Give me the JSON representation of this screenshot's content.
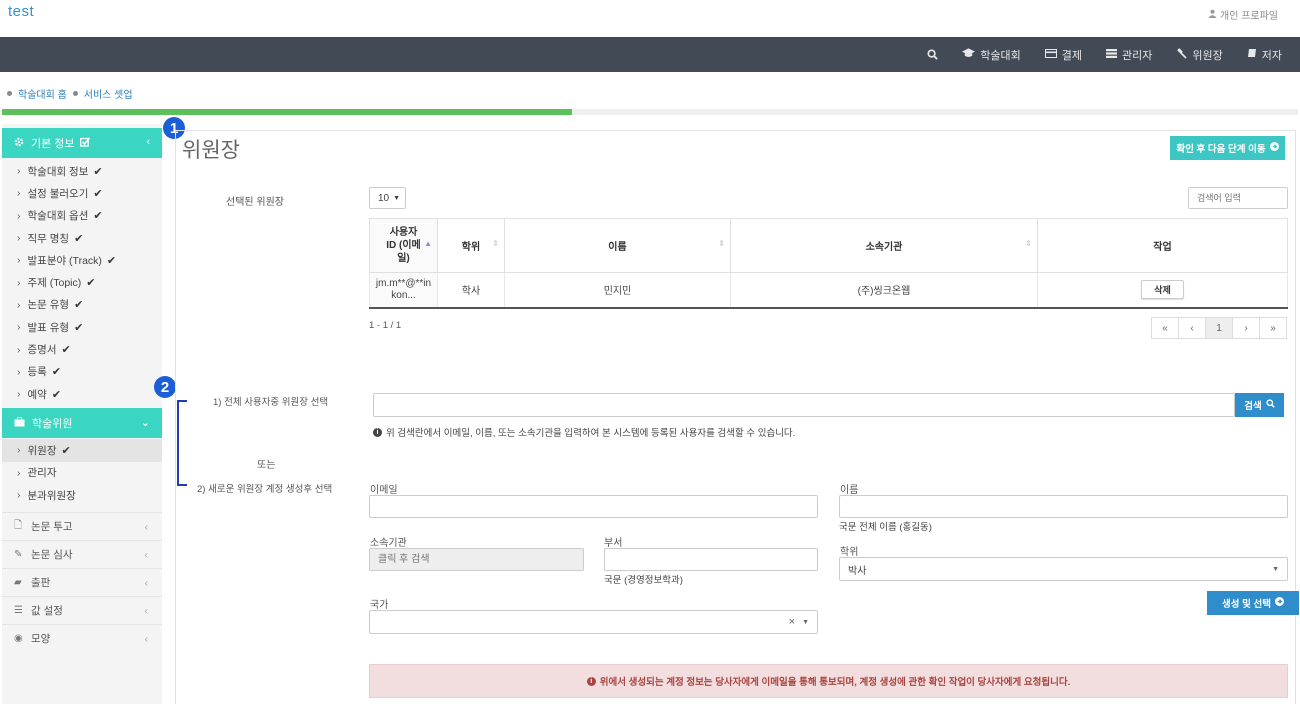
{
  "app": {
    "title": "test",
    "profile": "개인 프로파일"
  },
  "nav": {
    "items": [
      "학술대회",
      "결제",
      "관리자",
      "위원장",
      "저자"
    ]
  },
  "breadcrumb": [
    "학술대회 홈",
    "서비스 셋업"
  ],
  "progress": 0.44,
  "sidebar": {
    "basic_header": "기본 정보",
    "basic_items": [
      "학술대회 정보",
      "설정 불러오기",
      "학술대회 옵션",
      "직무 명칭",
      "발표분야 (Track)",
      "주제 (Topic)",
      "논문 유형",
      "발표 유형",
      "증명서",
      "등록",
      "예약"
    ],
    "committee_header": "학술위원",
    "committee_items": [
      "위원장",
      "관리자",
      "분과위원장"
    ],
    "sections": [
      "논문 투고",
      "논문 심사",
      "출판",
      "값 설정",
      "모양"
    ]
  },
  "badges": [
    "1",
    "2"
  ],
  "page": {
    "title": "위원장",
    "next_button": "확인 후 다음 단계 이동",
    "selected_label": "선택된 위원장",
    "page_size": "10",
    "search_placeholder": "검색어 입력",
    "table": {
      "headers": [
        "사용자 ID (이메일)",
        "학위",
        "이름",
        "소속기관",
        "작업"
      ],
      "rows": [
        {
          "id": "jm.m**@**inkon...",
          "degree": "학사",
          "name": "민지민",
          "org": "(주)씽크온웹",
          "action": "삭제"
        }
      ]
    },
    "count": "1 - 1 / 1",
    "pager": [
      "«",
      "‹",
      "1",
      "›",
      "»"
    ],
    "option1_label": "1) 전체 사용자중 위원장 선택",
    "search_button": "검색",
    "search_help": "위 검색란에서 이메일, 이름, 또는 소속기관을 입력하여 본 시스템에 등록된 사용자를 검색할 수 있습니다.",
    "or_label": "또는",
    "option2_label": "2) 새로운 위원장 계정 생성후 선택",
    "form": {
      "email_label": "이메일",
      "name_label": "이름",
      "name_hint": "국문 전체 이름 (홍길동)",
      "org_label": "소속기관",
      "org_placeholder": "클릭 후 검색",
      "dept_label": "부서",
      "dept_hint": "국문 (경영정보학과)",
      "degree_label": "학위",
      "degree_value": "박사",
      "country_label": "국가",
      "create_button": "생성 및 선택"
    },
    "alert": "위에서 생성되는 계정 정보는 당사자에게 이메일을 통해 통보되며, 계정 생성에 관한 확인 작업이 당사자에게 요청됩니다."
  }
}
